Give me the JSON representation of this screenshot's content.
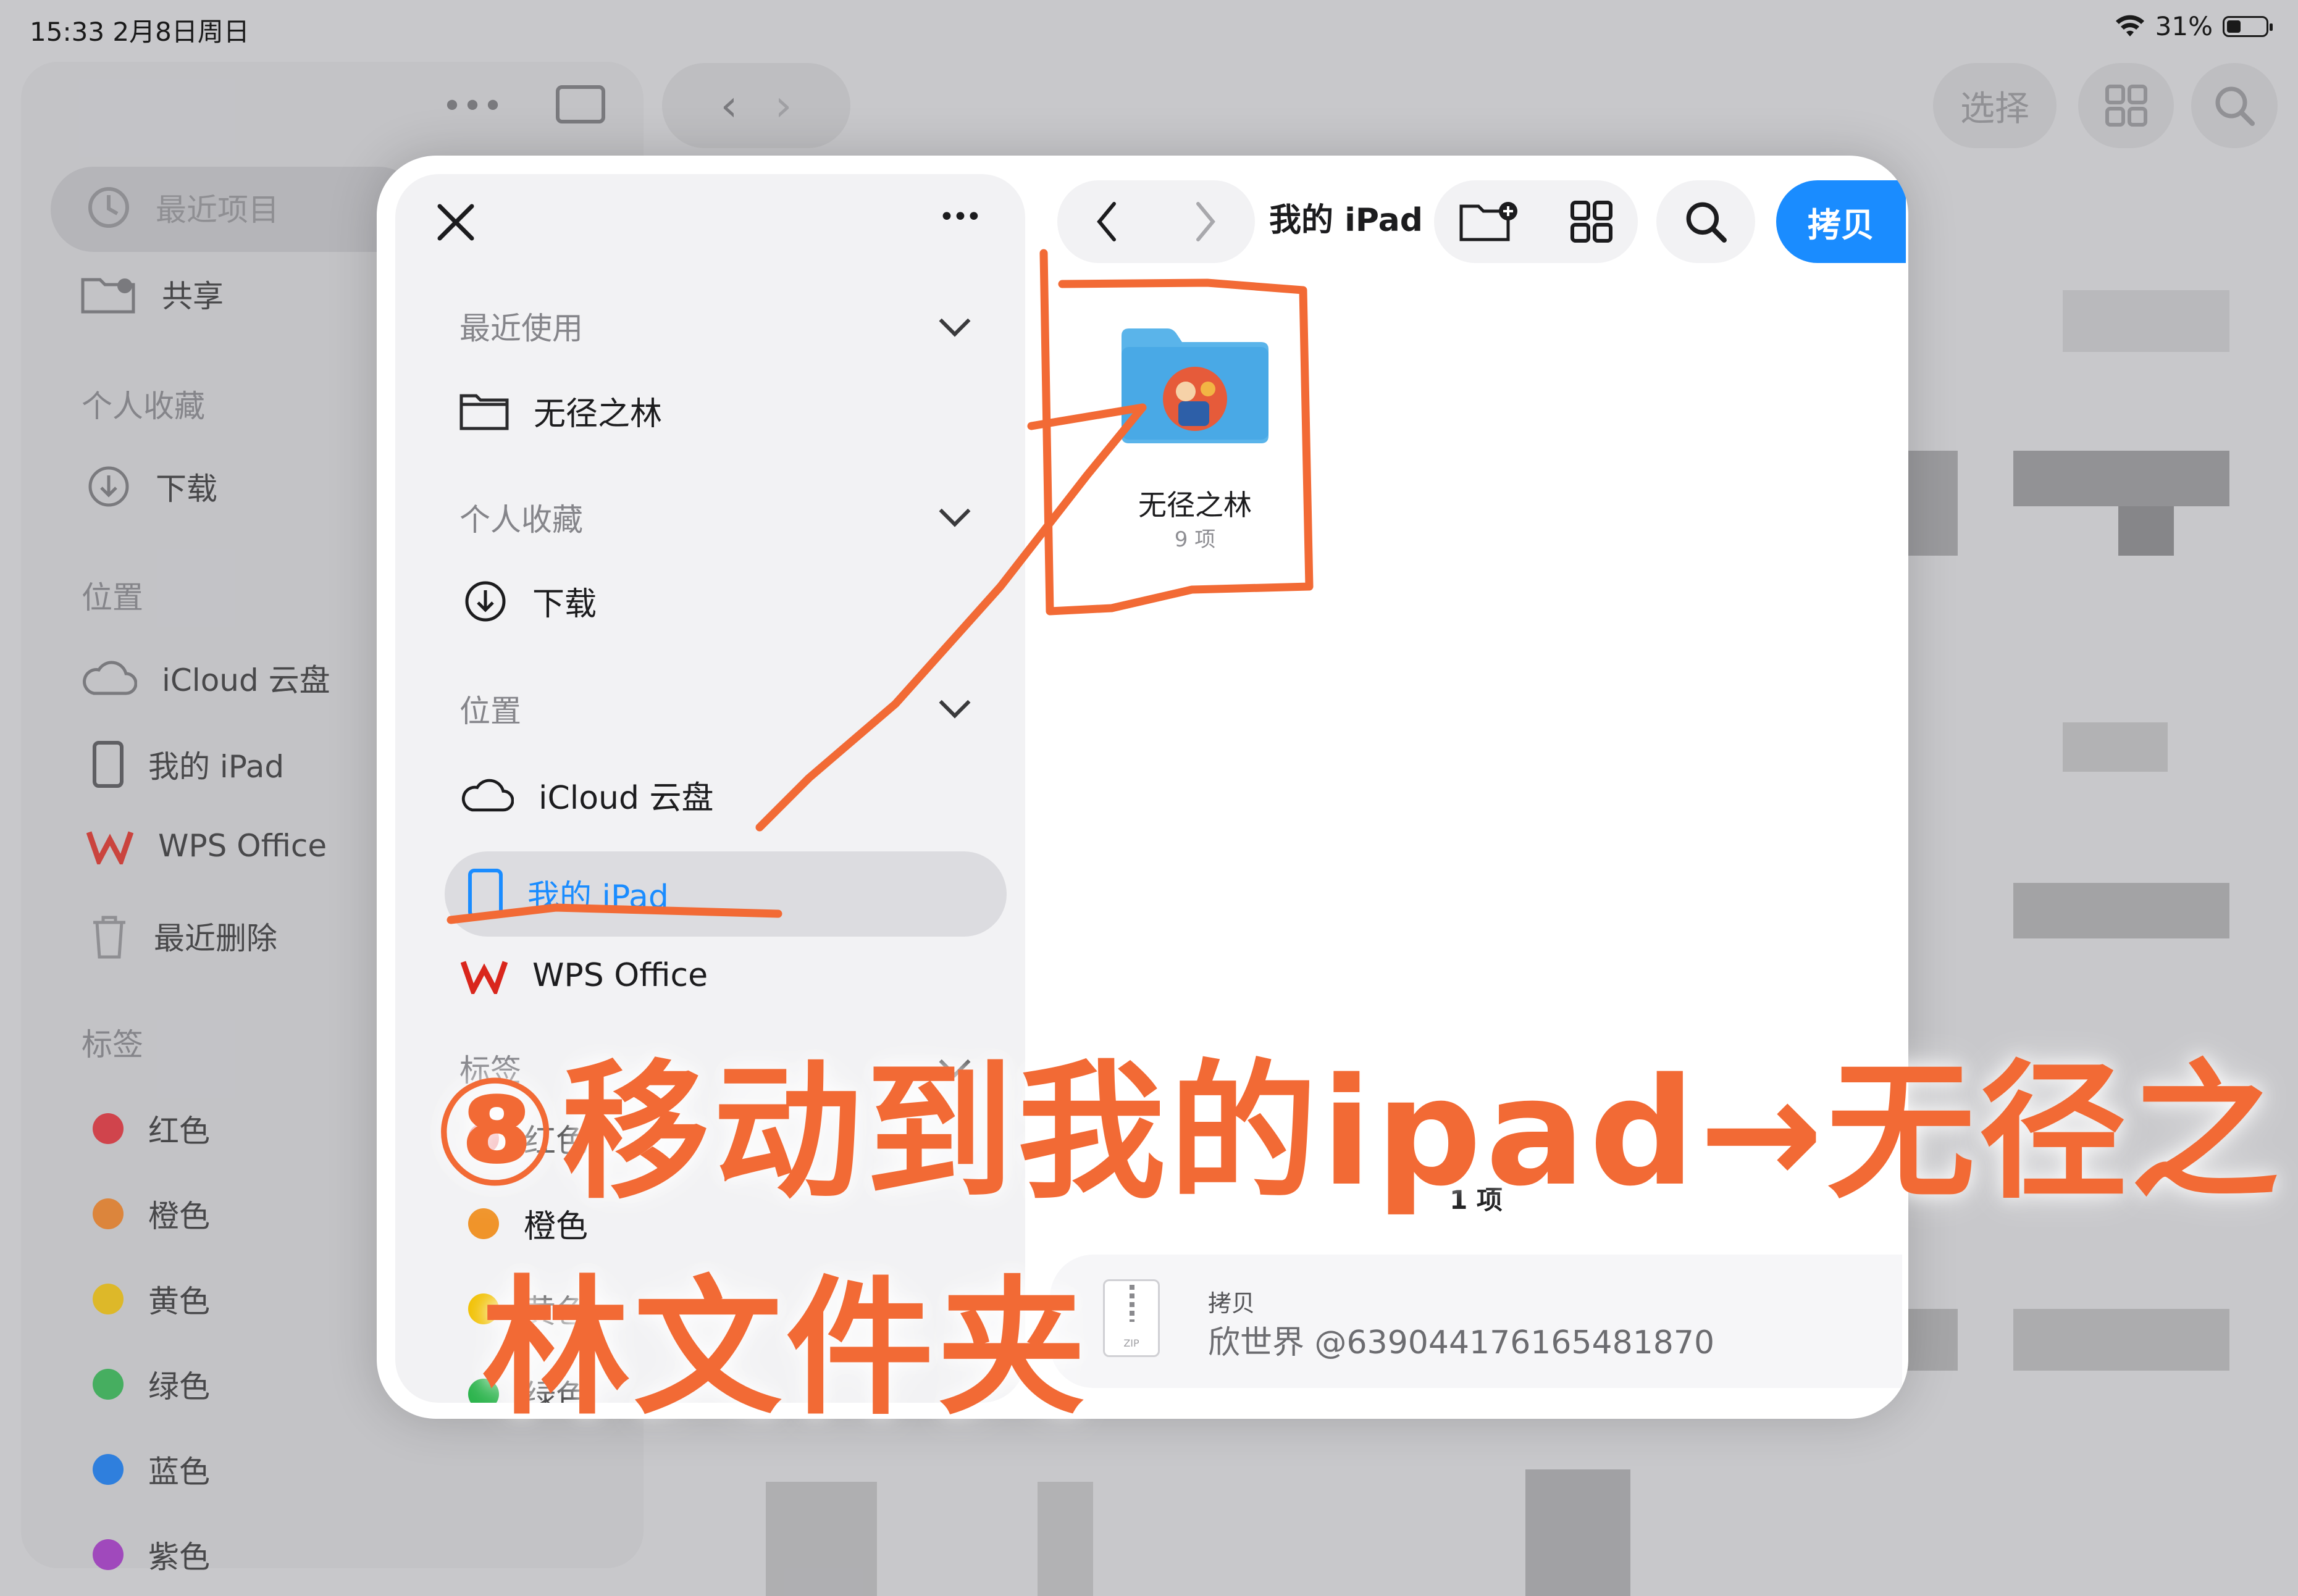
{
  "status_bar": {
    "time_date": "15:33  2月8日周日",
    "battery": "31%"
  },
  "background_app": {
    "toolbar": {
      "select_label": "选择"
    },
    "sidebar": {
      "recents": "最近项目",
      "shared": "共享",
      "favorites_header": "个人收藏",
      "downloads": "下载",
      "locations_header": "位置",
      "icloud": "iCloud 云盘",
      "my_ipad": "我的 iPad",
      "wps": "WPS Office",
      "recently_deleted": "最近删除",
      "tags_header": "标签",
      "tags": [
        {
          "label": "红色",
          "color": "#e0262f"
        },
        {
          "label": "橙色",
          "color": "#f07d1a"
        },
        {
          "label": "黄色",
          "color": "#f2c100"
        },
        {
          "label": "绿色",
          "color": "#29b34a"
        },
        {
          "label": "蓝色",
          "color": "#0a74f0"
        },
        {
          "label": "紫色",
          "color": "#a12dc4"
        }
      ]
    }
  },
  "picker": {
    "sidebar": {
      "recently_used_header": "最近使用",
      "recent_folder": "无径之林",
      "favorites_header": "个人收藏",
      "downloads": "下载",
      "locations_header": "位置",
      "icloud": "iCloud 云盘",
      "my_ipad": "我的 iPad",
      "wps": "WPS Office",
      "tags_header": "标签",
      "tags": [
        {
          "label": "红色",
          "color": "#e0262f"
        },
        {
          "label": "橙色",
          "color": "#f0942a"
        },
        {
          "label": "黄色",
          "color": "#f2c100"
        },
        {
          "label": "绿色",
          "color": "#29b34a"
        }
      ]
    },
    "toolbar": {
      "location_title": "我的 iPad",
      "copy_button": "拷贝"
    },
    "content": {
      "folder_name": "无径之林",
      "folder_count": "9 项",
      "items_count": "1 项"
    },
    "copy_card": {
      "kicker": "拷贝",
      "file_name": "欣世界 @639044176165481870",
      "file_type": "ZIP"
    }
  },
  "annotation": {
    "line1": "⑧移动到我的ipad→无径之",
    "line2": "林文件夹",
    "color": "#f26a35"
  }
}
